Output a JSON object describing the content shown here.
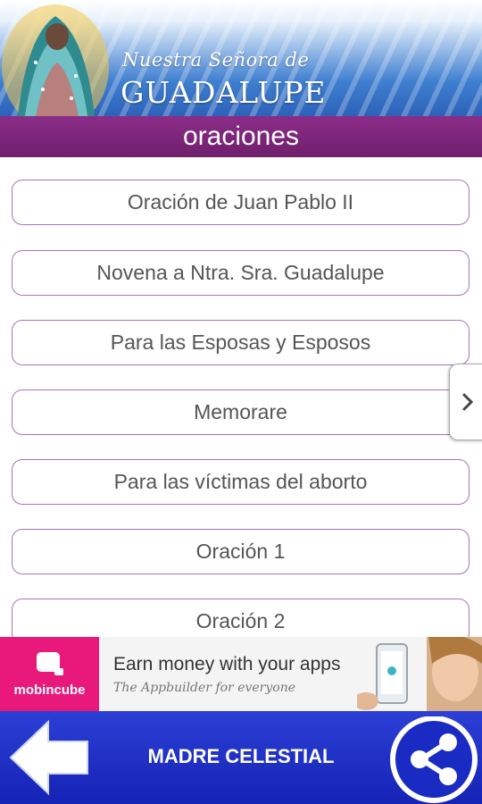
{
  "header": {
    "subtitle": "Nuestra Señora de",
    "title": "GUADALUPE"
  },
  "section": {
    "title": "oraciones"
  },
  "prayers": [
    {
      "label": "Oración de Juan Pablo II"
    },
    {
      "label": "Novena a Ntra. Sra. Guadalupe"
    },
    {
      "label": "Para las Esposas y Esposos"
    },
    {
      "label": "Memorare"
    },
    {
      "label": "Para las víctimas del aborto"
    },
    {
      "label": "Oración 1"
    },
    {
      "label": "Oración 2"
    }
  ],
  "side_tab": {
    "icon": "chevron-right-icon",
    "glyph": "›"
  },
  "ad": {
    "brand": "mobincube",
    "headline": "Earn money with your apps",
    "tagline": "The Appbuilder for everyone",
    "brand_color": "#e8197b"
  },
  "bottom_bar": {
    "title": "MADRE CELESTIAL",
    "back_icon": "back-arrow-icon",
    "share_icon": "share-icon",
    "color": "#1a2bc4"
  },
  "colors": {
    "accent_purple": "#7a2478",
    "button_border": "#a276b8",
    "header_blue": "#3f7fd0"
  }
}
